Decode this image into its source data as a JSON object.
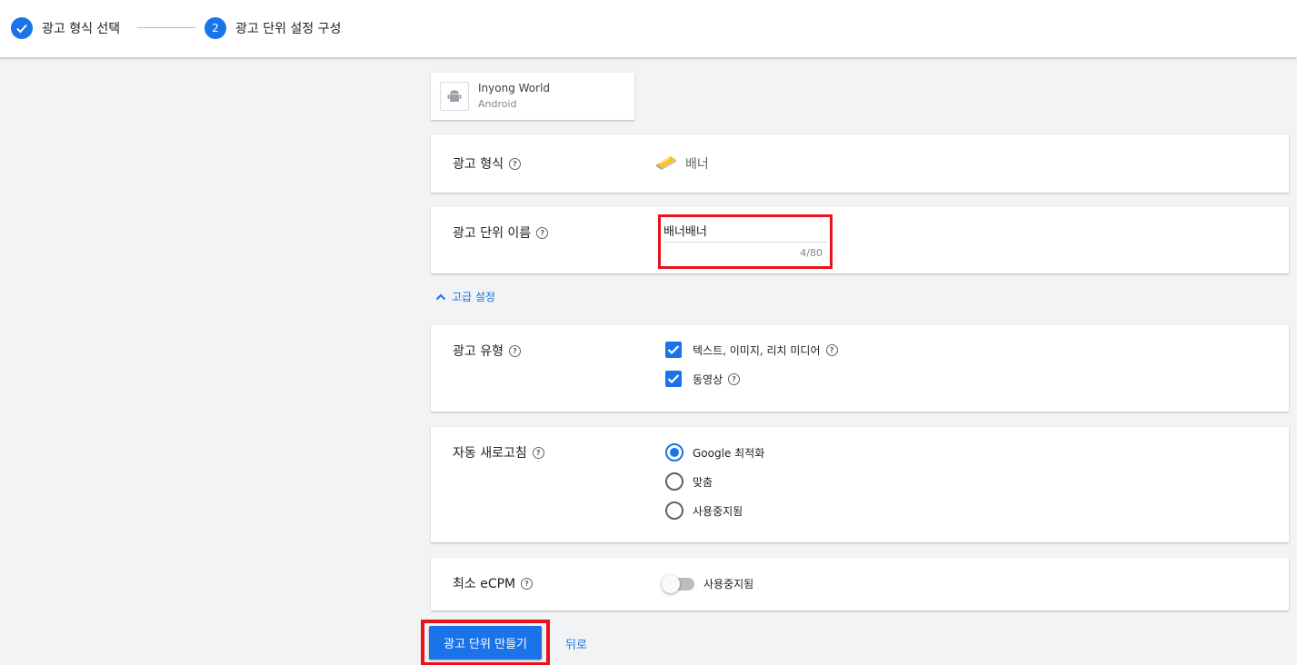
{
  "stepper": {
    "step1": {
      "label": "광고 형식 선택",
      "state": "completed"
    },
    "step2": {
      "number": "2",
      "label": "광고 단위 설정 구성",
      "state": "active"
    }
  },
  "app": {
    "name": "Inyong World",
    "platform": "Android",
    "icon": "android-icon"
  },
  "ad_format": {
    "label": "광고 형식",
    "value": "배너",
    "icon": "banner-icon"
  },
  "ad_unit_name": {
    "label": "광고 단위 이름",
    "value": "배너배너",
    "counter": "4/80"
  },
  "advanced": {
    "label": "고급 설정",
    "expanded": true
  },
  "ad_type": {
    "label": "광고 유형",
    "options": [
      {
        "label": "텍스트, 이미지, 리치 미디어",
        "checked": true
      },
      {
        "label": "동영상",
        "checked": true
      }
    ]
  },
  "auto_refresh": {
    "label": "자동 새로고침",
    "options": [
      {
        "label": "Google 최적화",
        "selected": true
      },
      {
        "label": "맞춤",
        "selected": false
      },
      {
        "label": "사용중지됨",
        "selected": false
      }
    ]
  },
  "min_ecpm": {
    "label": "최소 eCPM",
    "toggle_label": "사용중지됨",
    "enabled": false
  },
  "actions": {
    "create_label": "광고 단위 만들기",
    "back_label": "뒤로"
  },
  "colors": {
    "accent": "#1a73e8",
    "highlight": "#e8131c",
    "background": "#f1f3f4"
  }
}
